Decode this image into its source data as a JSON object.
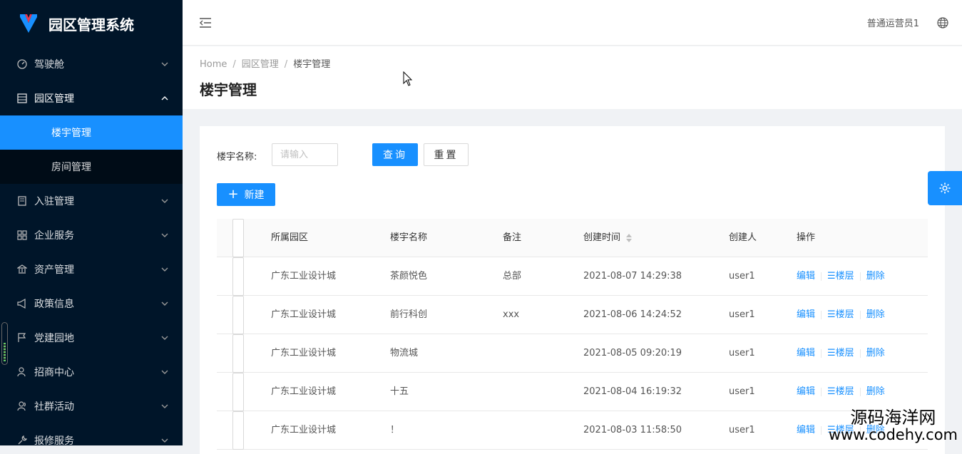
{
  "app": {
    "title": "园区管理系统"
  },
  "sidebar": {
    "items": [
      {
        "label": "驾驶舱",
        "icon": "dashboard-icon"
      },
      {
        "label": "园区管理",
        "icon": "table-icon",
        "open": true,
        "children": [
          {
            "label": "楼宇管理",
            "active": true
          },
          {
            "label": "房间管理"
          }
        ]
      },
      {
        "label": "入驻管理",
        "icon": "book-icon"
      },
      {
        "label": "企业服务",
        "icon": "appstore-icon"
      },
      {
        "label": "资产管理",
        "icon": "bank-icon"
      },
      {
        "label": "政策信息",
        "icon": "notification-icon"
      },
      {
        "label": "党建园地",
        "icon": "flag-icon"
      },
      {
        "label": "招商中心",
        "icon": "user-icon"
      },
      {
        "label": "社群活动",
        "icon": "team-icon"
      },
      {
        "label": "报修服务",
        "icon": "tool-icon"
      }
    ]
  },
  "header": {
    "username": "普通运营员1"
  },
  "breadcrumb": [
    "Home",
    "园区管理",
    "楼宇管理"
  ],
  "page": {
    "title": "楼宇管理"
  },
  "filter": {
    "label": "楼宇名称:",
    "placeholder": "请输入",
    "value": "",
    "query_label": "查询",
    "reset_label": "重置"
  },
  "toolbar": {
    "new_label": "新建"
  },
  "table": {
    "columns": [
      "所属园区",
      "楼宇名称",
      "备注",
      "创建时间",
      "创建人",
      "操作"
    ],
    "rows": [
      {
        "park": "广东工业设计城",
        "name": "茶颜悦色",
        "note": "总部",
        "created": "2021-08-07 14:29:38",
        "creator": "user1"
      },
      {
        "park": "广东工业设计城",
        "name": "前行科创",
        "note": "xxx",
        "created": "2021-08-06 14:24:52",
        "creator": "user1"
      },
      {
        "park": "广东工业设计城",
        "name": "物流城",
        "note": "",
        "created": "2021-08-05 09:20:19",
        "creator": "user1"
      },
      {
        "park": "广东工业设计城",
        "name": "十五",
        "note": "",
        "created": "2021-08-04 16:19:32",
        "creator": "user1"
      },
      {
        "park": "广东工业设计城",
        "name": "！",
        "note": "",
        "created": "2021-08-03 11:58:50",
        "creator": "user1"
      }
    ],
    "actions": {
      "edit": "编辑",
      "floors": "楼层",
      "delete": "删除"
    }
  },
  "watermark": {
    "line1": "源码海洋网",
    "line2": "www.codehy.com"
  },
  "colors": {
    "sidebar": "#001529",
    "primary": "#1890ff"
  }
}
